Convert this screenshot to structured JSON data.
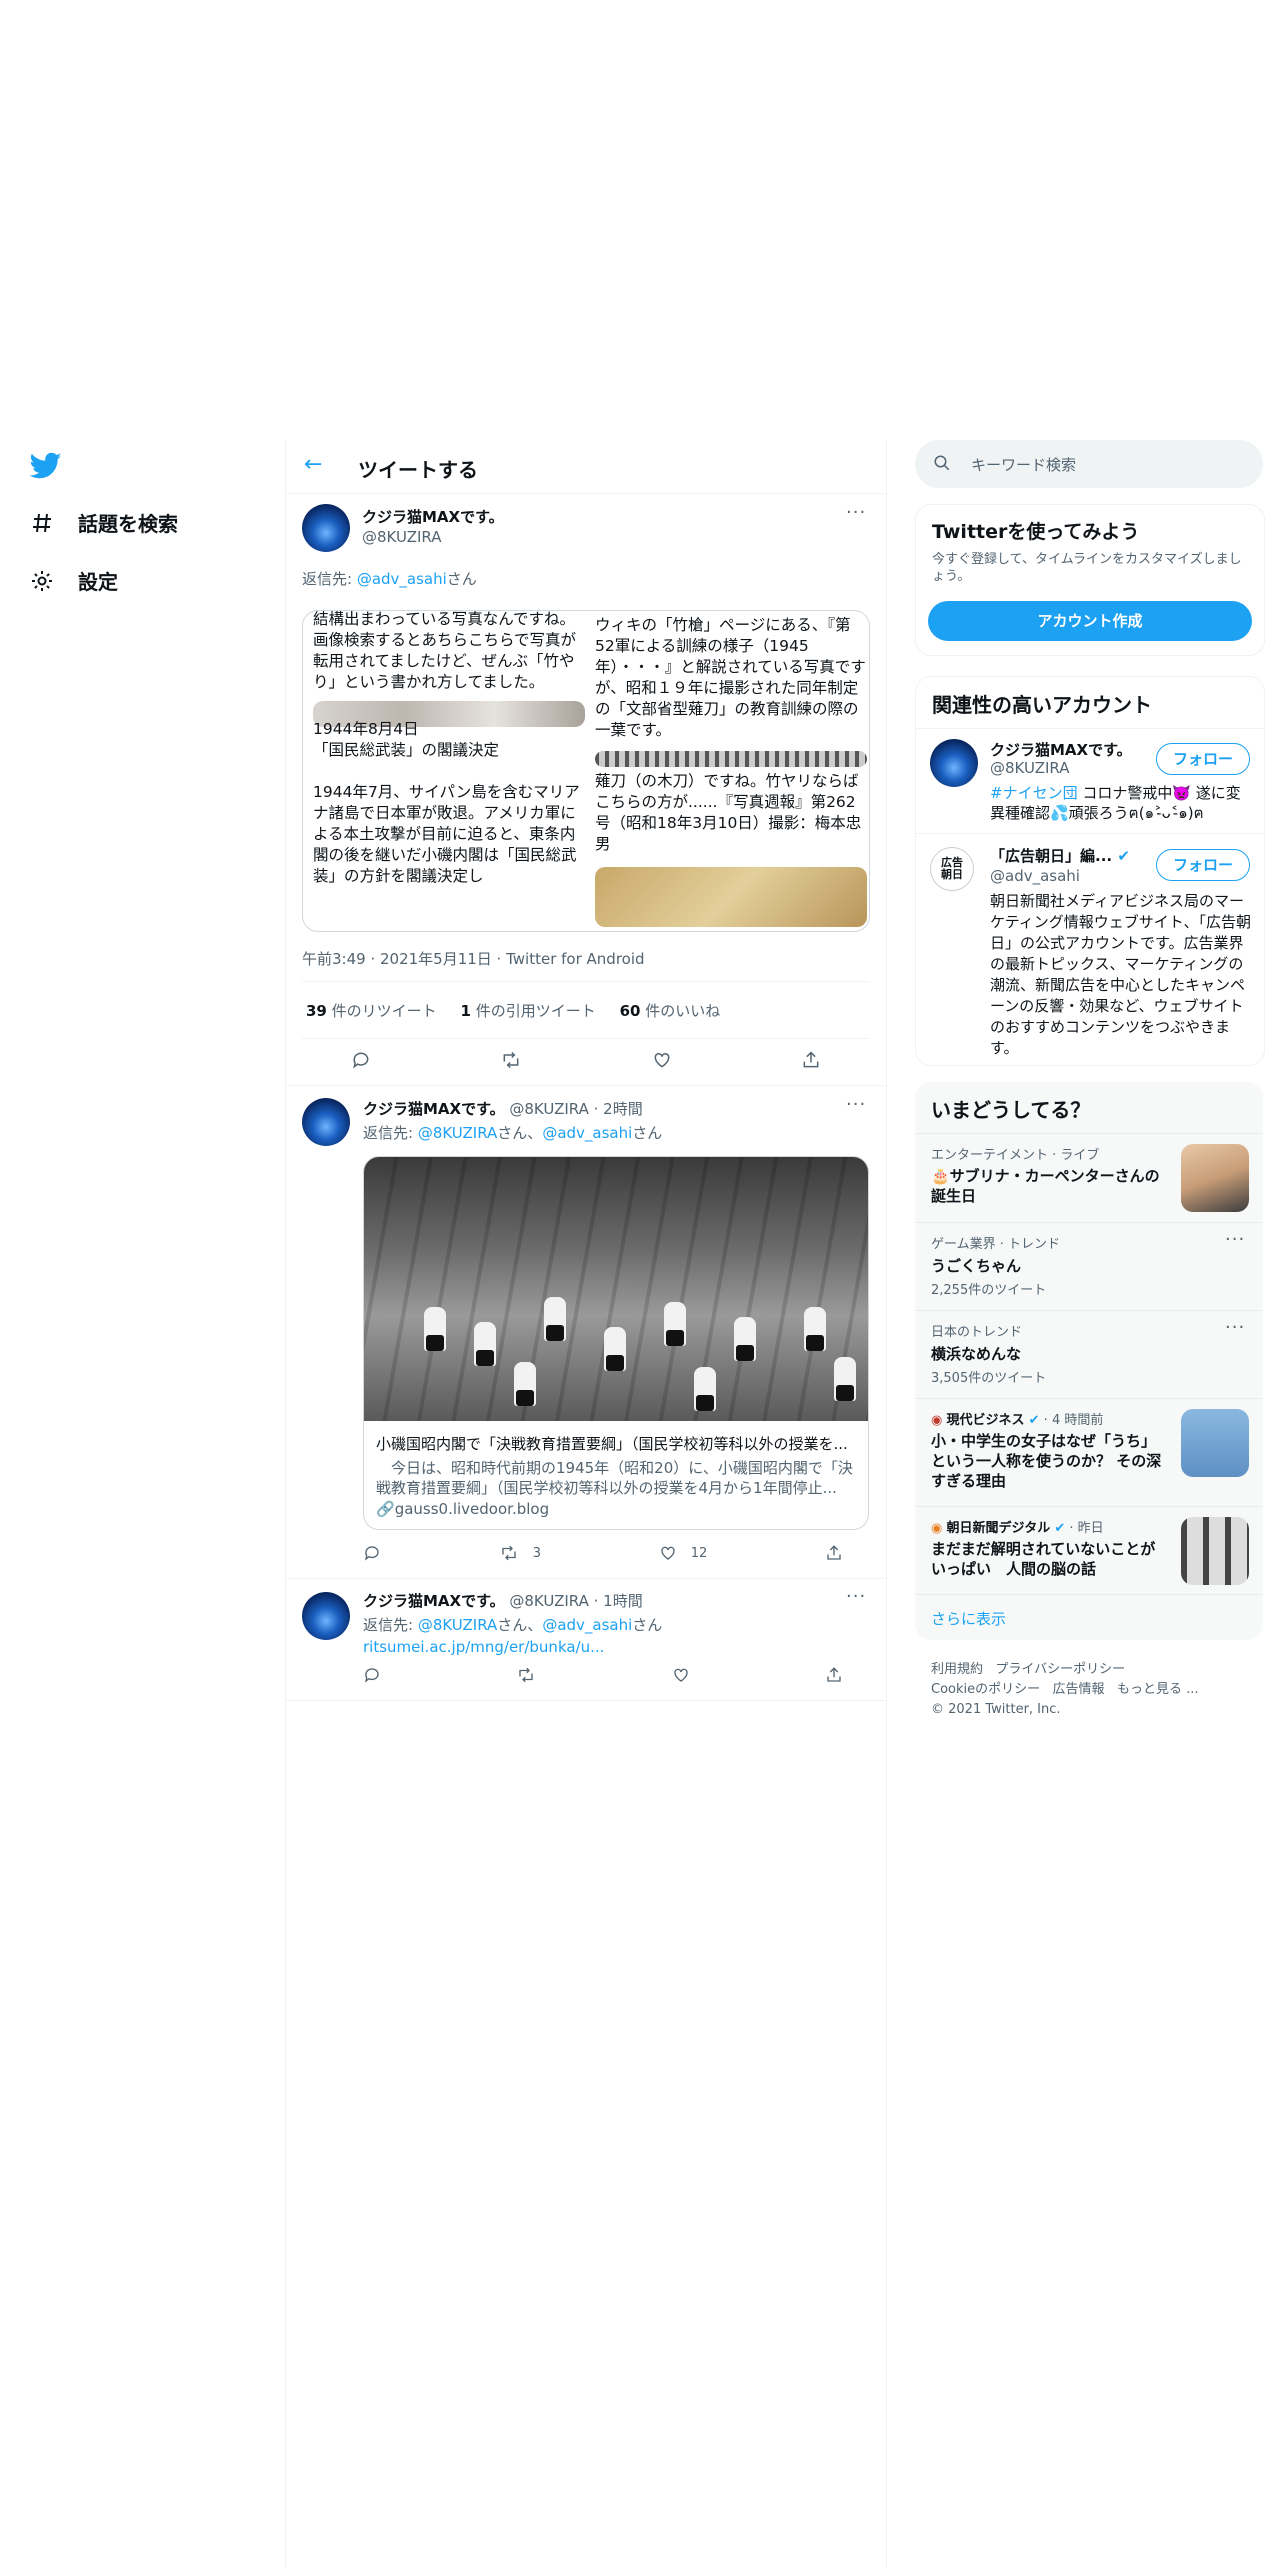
{
  "nav": {
    "items": [
      {
        "label": "話題を検索",
        "icon": "hashtag-icon"
      },
      {
        "label": "設定",
        "icon": "gear-icon"
      }
    ]
  },
  "header": {
    "title": "ツイートする"
  },
  "main_tweet": {
    "name": "クジラ猫MAXです。",
    "handle": "@8KUZIRA",
    "reply_to_prefix": "返信先: ",
    "reply_to_handle": "@adv_asahi",
    "reply_to_suffix": "さん",
    "quote_left": {
      "text1": "結構出まわっている写真なんですね。\n画像検索するとあちらこちらで写真が転用されてましたけど、ぜんぶ「竹やり」という書かれ方してました。",
      "text2": "1944年8月4日\n「国民総武装」の閣議決定\n\n1944年7月、サイパン島を含むマリアナ諸島で日本軍が敗退。アメリカ軍による本土攻撃が目前に迫ると、東条内閣の後を継いだ小磯内閣は「国民総武装」の方針を閣議決定し"
    },
    "quote_right": {
      "text1": "ウィキの「竹槍」ページにある、『第52軍による訓練の様子（1945年）・・・』と解説されている写真ですが、昭和１９年に撮影された同年制定の「文部省型薙刀」の教育訓練の際の一葉です。",
      "text2": "薙刀（の木刀）ですね。竹ヤリならばこちらの方が......『写真週報』第262号（昭和18年3月10日）撮影：梅本忠男"
    },
    "timestamp": "午前3:49 · 2021年5月11日 · Twitter for Android",
    "retweets_count": "39",
    "retweets_label": " 件のリツイート",
    "quotes_count": "1",
    "quotes_label": " 件の引用ツイート",
    "likes_count": "60",
    "likes_label": " 件のいいね"
  },
  "replies": [
    {
      "name": "クジラ猫MAXです。",
      "handle": "@8KUZIRA",
      "time": " · 2時間",
      "reply_prefix": "返信先: ",
      "reply_handle1": "@8KUZIRA",
      "reply_mid": "さん、",
      "reply_handle2": "@adv_asahi",
      "reply_suffix": "さん",
      "card_title": "小磯国昭内閣で「決戦教育措置要綱」（国民学校初等科以外の授業を...",
      "card_desc": "　今日は、昭和時代前期の1945年（昭和20）に、小磯国昭内閣で「決戦教育措置要綱」（国民学校初等科以外の授業を4月から1年間停止...",
      "card_domain": "gauss0.livedoor.blog",
      "retweets": "3",
      "likes": "12"
    },
    {
      "name": "クジラ猫MAXです。",
      "handle": "@8KUZIRA",
      "time": " · 1時間",
      "reply_prefix": "返信先: ",
      "reply_handle1": "@8KUZIRA",
      "reply_mid": "さん、",
      "reply_handle2": "@adv_asahi",
      "reply_suffix": "さん",
      "link": "ritsumei.ac.jp/mng/er/bunka/u..."
    }
  ],
  "sidebar": {
    "search_placeholder": "キーワード検索",
    "signup": {
      "title": "Twitterを使ってみよう",
      "desc": "今すぐ登録して、タイムラインをカスタマイズしましょう。",
      "button": "アカウント作成"
    },
    "related": {
      "title": "関連性の高いアカウント",
      "follow_label": "フォロー",
      "accounts": [
        {
          "name": "クジラ猫MAXです。",
          "handle": "@8KUZIRA",
          "bio_tag": "#ナイセン団",
          "bio": " コロナ警戒中👿 遂に変異種確認💦頑張ろうฅ(๑˃̵ᴗ˂̵๑)ฅ"
        },
        {
          "name": "「広告朝日」編...",
          "handle": "@adv_asahi",
          "logo_text": "広告朝日",
          "bio": "朝日新聞社メディアビジネス局のマーケティング情報ウェブサイト、「広告朝日」の公式アカウントです。広告業界の最新トピックス、マーケティングの潮流、新聞広告を中心としたキャンペーンの反響・効果など、ウェブサイトのおすすめコンテンツをつぶやきます。"
        }
      ]
    },
    "trends": {
      "title": "いまどうしてる？",
      "items": [
        {
          "category": "エンターテイメント · ライブ",
          "title": "🎂サブリナ・カーペンターさんの誕生日"
        },
        {
          "category": "ゲーム業界 · トレンド",
          "title": "うごくちゃん",
          "count": "2,255件のツイート"
        },
        {
          "category": "日本のトレンド",
          "title": "横浜なめんな",
          "count": "3,505件のツイート"
        },
        {
          "source": "現代ビジネス",
          "time": " · 4 時間前",
          "title": "小・中学生の女子はなぜ「うち」という一人称を使うのか？ その深すぎる理由"
        },
        {
          "source": "朝日新聞デジタル",
          "time": " · 昨日",
          "title": "まだまだ解明されていないことがいっぱい　人間の脳の話"
        }
      ],
      "show_more": "さらに表示"
    },
    "footer": {
      "line1a": "利用規約",
      "line1b": "プライバシーポリシー",
      "line2a": "Cookieのポリシー",
      "line2b": "広告情報",
      "line2c": "もっと見る ...",
      "line3": "© 2021 Twitter, Inc."
    }
  },
  "colors": {
    "accent": "#1da1f2",
    "text": "#0f1419",
    "muted": "#536471",
    "border": "#eff3f4"
  }
}
